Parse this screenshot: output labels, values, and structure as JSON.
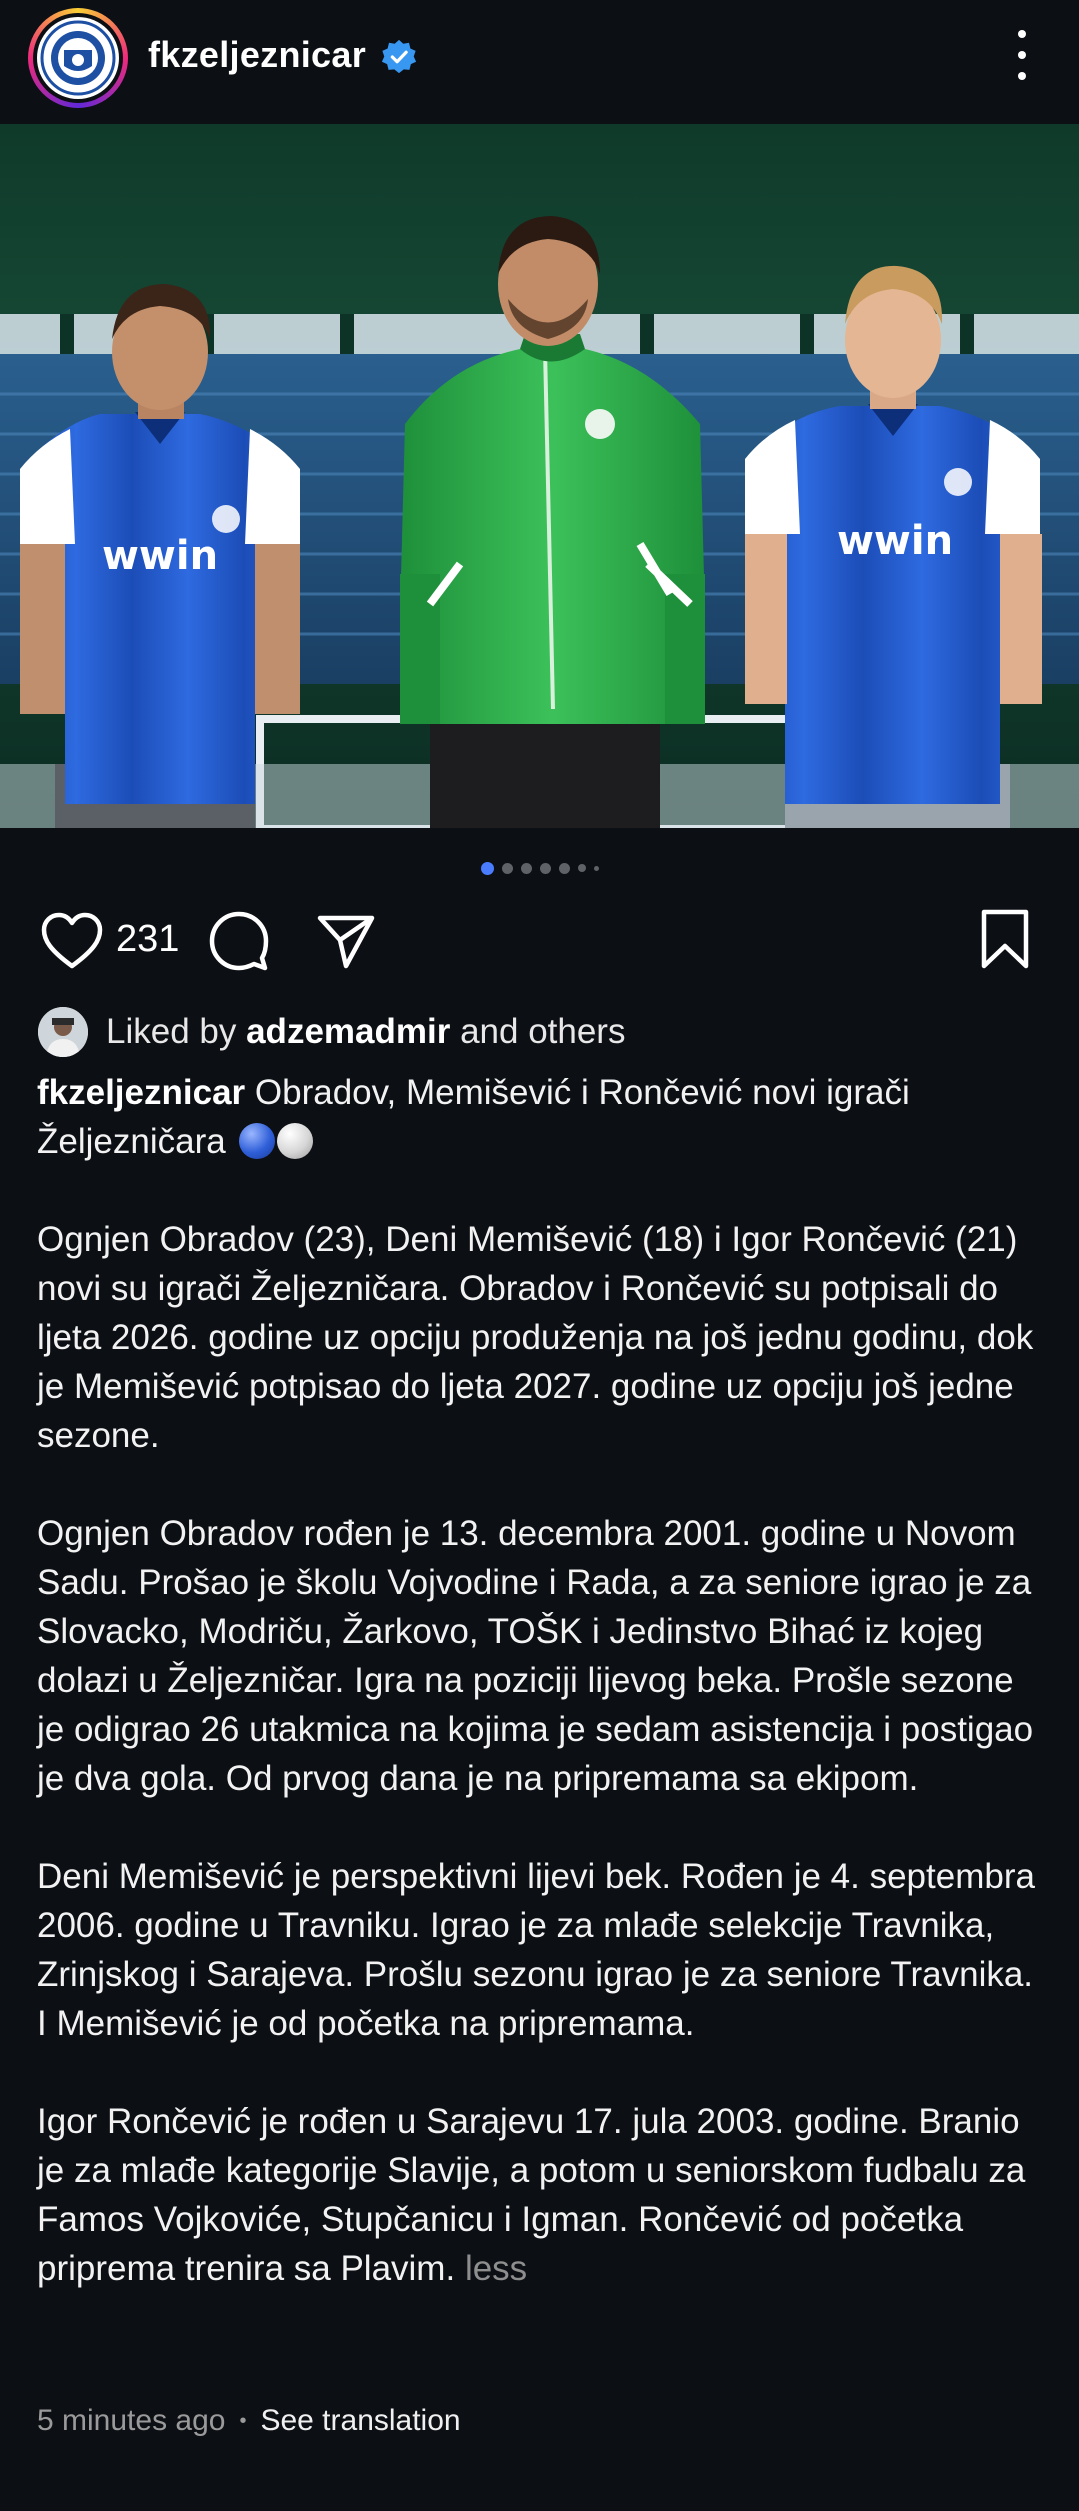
{
  "header": {
    "username": "fkzeljeznicar",
    "verified": true,
    "logo_text": "FK ŽELJEZNIČAR FOOTBALL CLUB"
  },
  "post": {
    "image_alt": "Three players presented in Željezničar kits",
    "kit_sponsor": "wwin",
    "carousel": {
      "count": 7,
      "active_index": 0
    }
  },
  "actions": {
    "like_count": "231"
  },
  "liked_by": {
    "prefix": "Liked by ",
    "user": "adzemadmir",
    "suffix": " and others"
  },
  "caption": {
    "user": "fkzeljeznicar",
    "headline": " Obradov, Memišević i Rončević novi igrači Željezničara ",
    "paragraphs": [
      "Ognjen Obradov (23), Deni Memišević (18) i Igor Rončević (21) novi su igrači Željezničara. Obradov i Rončević su potpisali do ljeta 2026. godine uz opciju produženja na još jednu godinu, dok je Memišević potpisao do ljeta 2027. godine uz opciju još jedne sezone.",
      "Ognjen Obradov rođen je 13. decembra 2001. godine u Novom Sadu. Prošao je školu Vojvodine i Rada, a za seniore igrao je za Slovacko, Modriču, Žarkovo, TOŠK i Jedinstvo Bihać iz kojeg dolazi u Željezničar. Igra na poziciji lijevog beka. Prošle sezone je odigrao 26 utakmica na kojima je sedam asistencija i postigao je dva gola. Od prvog dana je na pripremama sa ekipom.",
      "Deni Memišević je perspektivni lijevi bek. Rođen je 4. septembra 2006. godine u Travniku. Igrao je za mlađe selekcije Travnika, Zrinjskog i Sarajeva. Prošlu sezonu igrao je za seniore Travnika. I Memišević je od početka na pripremama.",
      "Igor Rončević je rođen u Sarajevu 17. jula 2003. godine. Branio je za mlađe kategorije Slavije, a potom u seniorskom fudbalu za Famos Vojkoviće, Stupčanicu i Igman. Rončević od početka priprema trenira sa Plavim."
    ],
    "less_label": "less"
  },
  "meta": {
    "time_ago": "5 minutes ago",
    "separator": "•",
    "translate_label": "See translation"
  },
  "colors": {
    "background": "#0c0f14",
    "accent_blue": "#4a7cff",
    "muted": "#8e8e8e"
  }
}
